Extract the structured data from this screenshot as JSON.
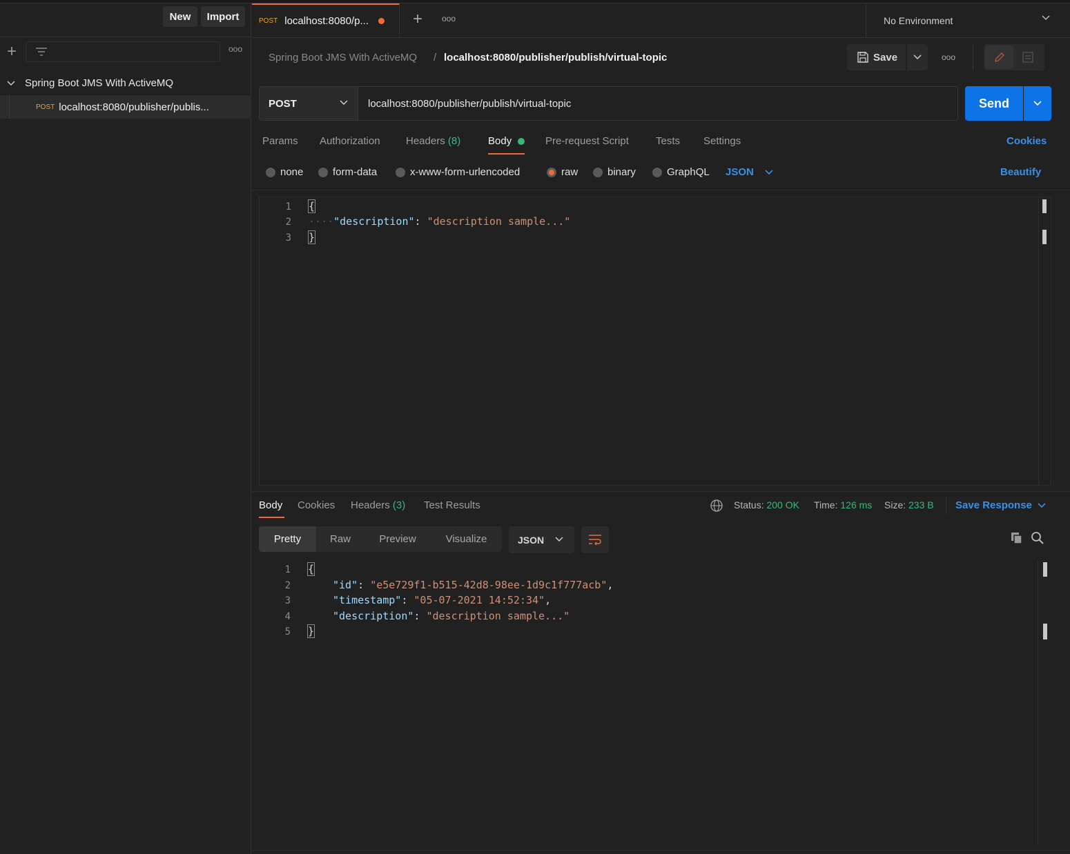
{
  "sidebar": {
    "new_label": "New",
    "import_label": "Import",
    "collection_name": "Spring Boot JMS With ActiveMQ",
    "request": {
      "method": "POST",
      "label": "localhost:8080/publisher/publis..."
    }
  },
  "tabs": {
    "active": {
      "method": "POST",
      "label": "localhost:8080/p..."
    },
    "environment": "No Environment"
  },
  "breadcrumb": {
    "parent": "Spring Boot JMS With ActiveMQ",
    "separator": "/",
    "current": "localhost:8080/publisher/publish/virtual-topic",
    "save_label": "Save"
  },
  "request": {
    "method": "POST",
    "url": "localhost:8080/publisher/publish/virtual-topic",
    "send_label": "Send",
    "tabs": {
      "params": "Params",
      "authorization": "Authorization",
      "headers": "Headers",
      "headers_count": "(8)",
      "body": "Body",
      "pre_request": "Pre-request Script",
      "tests": "Tests",
      "settings": "Settings"
    },
    "cookies_label": "Cookies",
    "body_types": {
      "none": "none",
      "form_data": "form-data",
      "urlencoded": "x-www-form-urlencoded",
      "raw": "raw",
      "binary": "binary",
      "graphql": "GraphQL"
    },
    "selected_body_type": "raw",
    "format": "JSON",
    "beautify_label": "Beautify",
    "editor": {
      "line_numbers": [
        "1",
        "2",
        "3"
      ],
      "open_brace": "{",
      "indent": "····",
      "key": "\"description\"",
      "colon": ": ",
      "value": "\"description sample...\"",
      "close_brace": "}"
    }
  },
  "response": {
    "tabs": {
      "body": "Body",
      "cookies": "Cookies",
      "headers": "Headers",
      "headers_count": "(3)",
      "test_results": "Test Results"
    },
    "status_label": "Status:",
    "status_value": "200 OK",
    "time_label": "Time:",
    "time_value": "126 ms",
    "size_label": "Size:",
    "size_value": "233 B",
    "save_response_label": "Save Response",
    "views": {
      "pretty": "Pretty",
      "raw": "Raw",
      "preview": "Preview",
      "visualize": "Visualize"
    },
    "format": "JSON",
    "editor": {
      "line_numbers": [
        "1",
        "2",
        "3",
        "4",
        "5"
      ],
      "open_brace": "{",
      "id_key": "\"id\"",
      "id_value": "\"e5e729f1-b515-42d8-98ee-1d9c1f777acb\"",
      "timestamp_key": "\"timestamp\"",
      "timestamp_value": "\"05-07-2021 14:52:34\"",
      "description_key": "\"description\"",
      "description_value": "\"description sample...\"",
      "close_brace": "}"
    }
  },
  "colors": {
    "accent": "#f26b3a",
    "primary_blue": "#0d73e6",
    "link_blue": "#3d8fe6",
    "success_green": "#3db67a",
    "post_method": "#e8a23b"
  }
}
